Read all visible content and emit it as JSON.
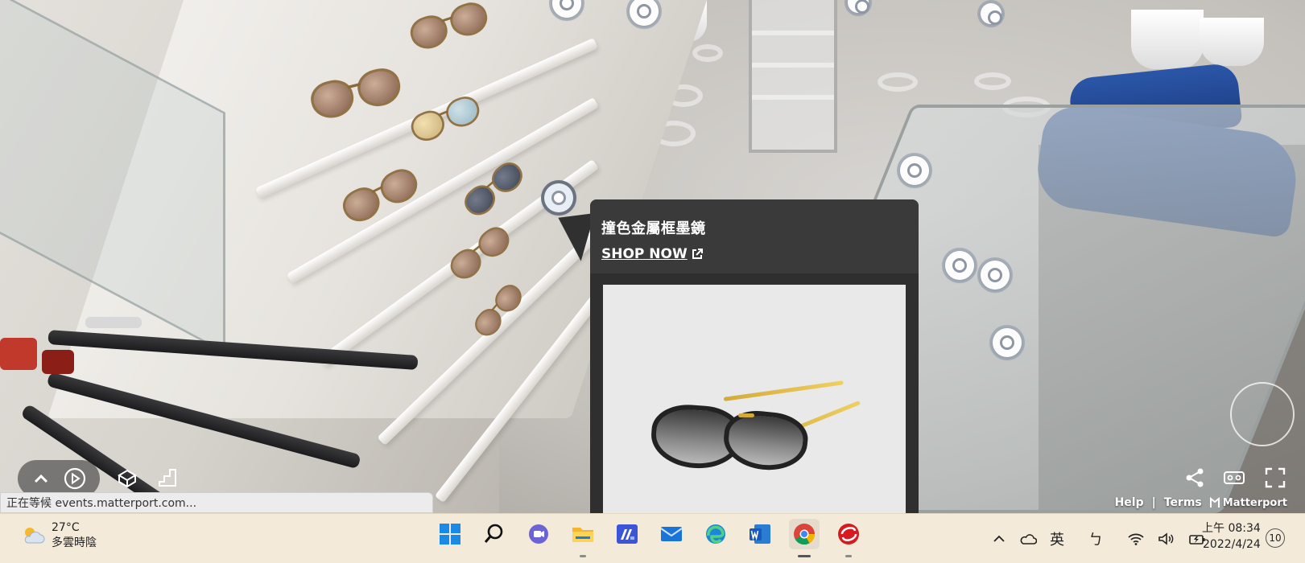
{
  "tag": {
    "title": "撞色金屬框墨鏡",
    "link_label": "SHOP NOW"
  },
  "browser_status": "正在等候 events.matterport.com...",
  "footer": {
    "help": "Help",
    "separator": "|",
    "terms": "Terms",
    "brand": "Matterport"
  },
  "taskbar": {
    "weather": {
      "temperature": "27°C",
      "condition": "多雲時陰"
    },
    "apps": [
      "Start",
      "Search",
      "Teams Chat",
      "File Explorer",
      "Microsoft Store",
      "Mail",
      "Edge",
      "Word",
      "Chrome",
      "Trend Micro"
    ],
    "ime_label": "英",
    "ime_bopomofo": "ㄅ",
    "clock": {
      "time": "上午 08:34",
      "date": "2022/4/24"
    },
    "notification_count": "10"
  },
  "colors": {
    "taskbar_bg": "#f3ead9",
    "tag_card_bg": "#2f2f2f",
    "chair_blue": "#1f4694"
  }
}
